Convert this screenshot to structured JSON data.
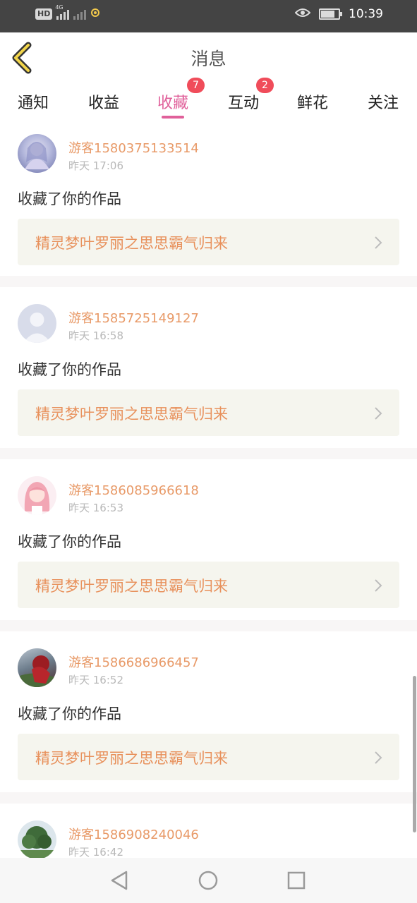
{
  "status_bar": {
    "network_label": "HD",
    "signal_type": "4G",
    "time": "10:39"
  },
  "header": {
    "title": "消息",
    "back_icon": "chevron-left-icon"
  },
  "tabs": [
    {
      "label": "通知",
      "badge": ""
    },
    {
      "label": "收益",
      "badge": ""
    },
    {
      "label": "收藏",
      "badge": "7",
      "active": true
    },
    {
      "label": "互动",
      "badge": "2"
    },
    {
      "label": "鲜花",
      "badge": ""
    },
    {
      "label": "关注",
      "badge": ""
    }
  ],
  "colors": {
    "accent": "#e0609a",
    "badge": "#f04c5a",
    "username": "#e89a68",
    "work_title": "#e8915c",
    "work_bg": "#f5f5ee"
  },
  "feed": [
    {
      "username": "游客1580375133514",
      "time": "昨天 17:06",
      "action": "收藏了你的作品",
      "work": "精灵梦叶罗丽之思思霸气归来",
      "avatar": "anime-girl-avatar"
    },
    {
      "username": "游客1585725149127",
      "time": "昨天 16:58",
      "action": "收藏了你的作品",
      "work": "精灵梦叶罗丽之思思霸气归来",
      "avatar": "default-user-avatar"
    },
    {
      "username": "游客1586085966618",
      "time": "昨天 16:53",
      "action": "收藏了你的作品",
      "work": "精灵梦叶罗丽之思思霸气归来",
      "avatar": "pink-hair-doll-avatar"
    },
    {
      "username": "游客1586686966457",
      "time": "昨天 16:52",
      "action": "收藏了你的作品",
      "work": "精灵梦叶罗丽之思思霸气归来",
      "avatar": "photo-avatar"
    },
    {
      "username": "游客1586908240046",
      "time": "昨天 16:42",
      "action": "",
      "work": "",
      "avatar": "tree-photo-avatar"
    }
  ],
  "nav_bar": {
    "back": "nav-back-icon",
    "home": "nav-home-icon",
    "recents": "nav-recents-icon"
  }
}
